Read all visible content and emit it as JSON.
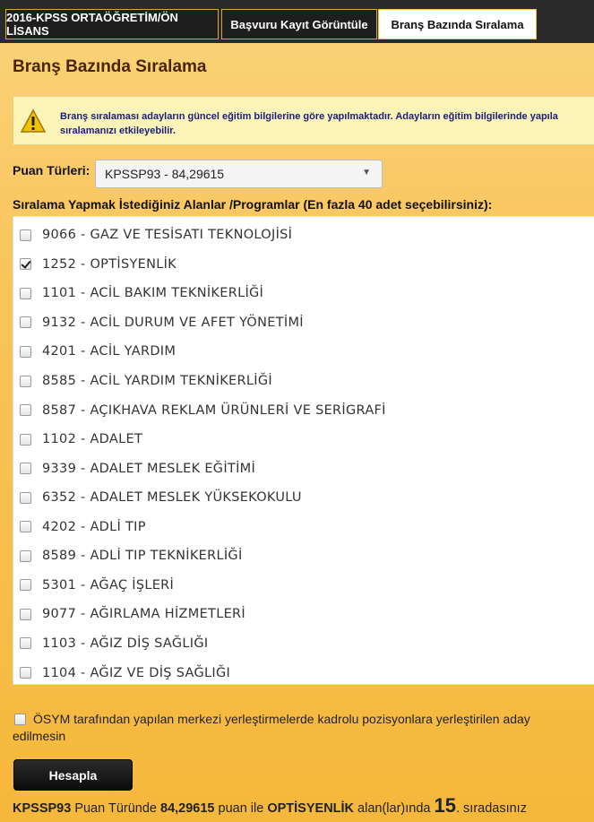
{
  "tabs": [
    {
      "label": "2016-KPSS ORTAÖĞRETİM/ÖN LİSANS",
      "active": false
    },
    {
      "label": "Başvuru Kayıt Görüntüle",
      "active": false
    },
    {
      "label": "Branş Bazında Sıralama",
      "active": true
    }
  ],
  "page_title": "Branş Bazında Sıralama",
  "warning": {
    "icon": "warning-icon",
    "text": "Branş sıralaması adayların güncel eğitim bilgilerine göre yapılmaktadır. Adayların eğitim bilgilerinde yapıla\nsıralamanızı etkileyebilir."
  },
  "puan": {
    "label": "Puan Türleri:",
    "selected": "KPSSP93 - 84,29615"
  },
  "list_label": "Sıralama Yapmak İstediğiniz Alanlar /Programlar (En fazla 40 adet seçebilirsiniz):",
  "programs": [
    {
      "label": "9066 - GAZ VE TESİSATI TEKNOLOJİSİ",
      "checked": false
    },
    {
      "label": "1252 - OPTİSYENLİK",
      "checked": true
    },
    {
      "label": "1101 - ACİL BAKIM TEKNİKERLİĞİ",
      "checked": false
    },
    {
      "label": "9132 - ACİL DURUM VE AFET YÖNETİMİ",
      "checked": false
    },
    {
      "label": "4201 - ACİL YARDIM",
      "checked": false
    },
    {
      "label": "8585 - ACİL YARDIM TEKNİKERLİĞİ",
      "checked": false
    },
    {
      "label": "8587 - AÇIKHAVA REKLAM ÜRÜNLERİ VE SERİGRAFİ",
      "checked": false
    },
    {
      "label": "1102 - ADALET",
      "checked": false
    },
    {
      "label": "9339 - ADALET MESLEK EĞİTİMİ",
      "checked": false
    },
    {
      "label": "6352 - ADALET MESLEK YÜKSEKOKULU",
      "checked": false
    },
    {
      "label": "4202 - ADLİ TIP",
      "checked": false
    },
    {
      "label": "8589 - ADLİ TIP TEKNİKERLİĞİ",
      "checked": false
    },
    {
      "label": "5301 - AĞAÇ İŞLERİ",
      "checked": false
    },
    {
      "label": "9077 - AĞIRLAMA HİZMETLERİ",
      "checked": false
    },
    {
      "label": "1103 - AĞIZ DİŞ SAĞLIĞI",
      "checked": false
    },
    {
      "label": "1104 - AĞIZ VE DİŞ SAĞLIĞI",
      "checked": false
    }
  ],
  "osym": {
    "checked": false,
    "text": "ÖSYM tarafından yapılan merkezi yerleştirmelerde kadrolu pozisyonlara yerleştirilen aday\nedilmesin"
  },
  "button_label": "Hesapla",
  "result": {
    "puan_type": "KPSSP93",
    "text1": " Puan Türünde ",
    "score": "84,29615",
    "text2": " puan ile ",
    "program": "OPTİSYENLİK",
    "text3": " alan(lar)ında ",
    "rank": "15",
    "text4": ". sıradasınız"
  }
}
